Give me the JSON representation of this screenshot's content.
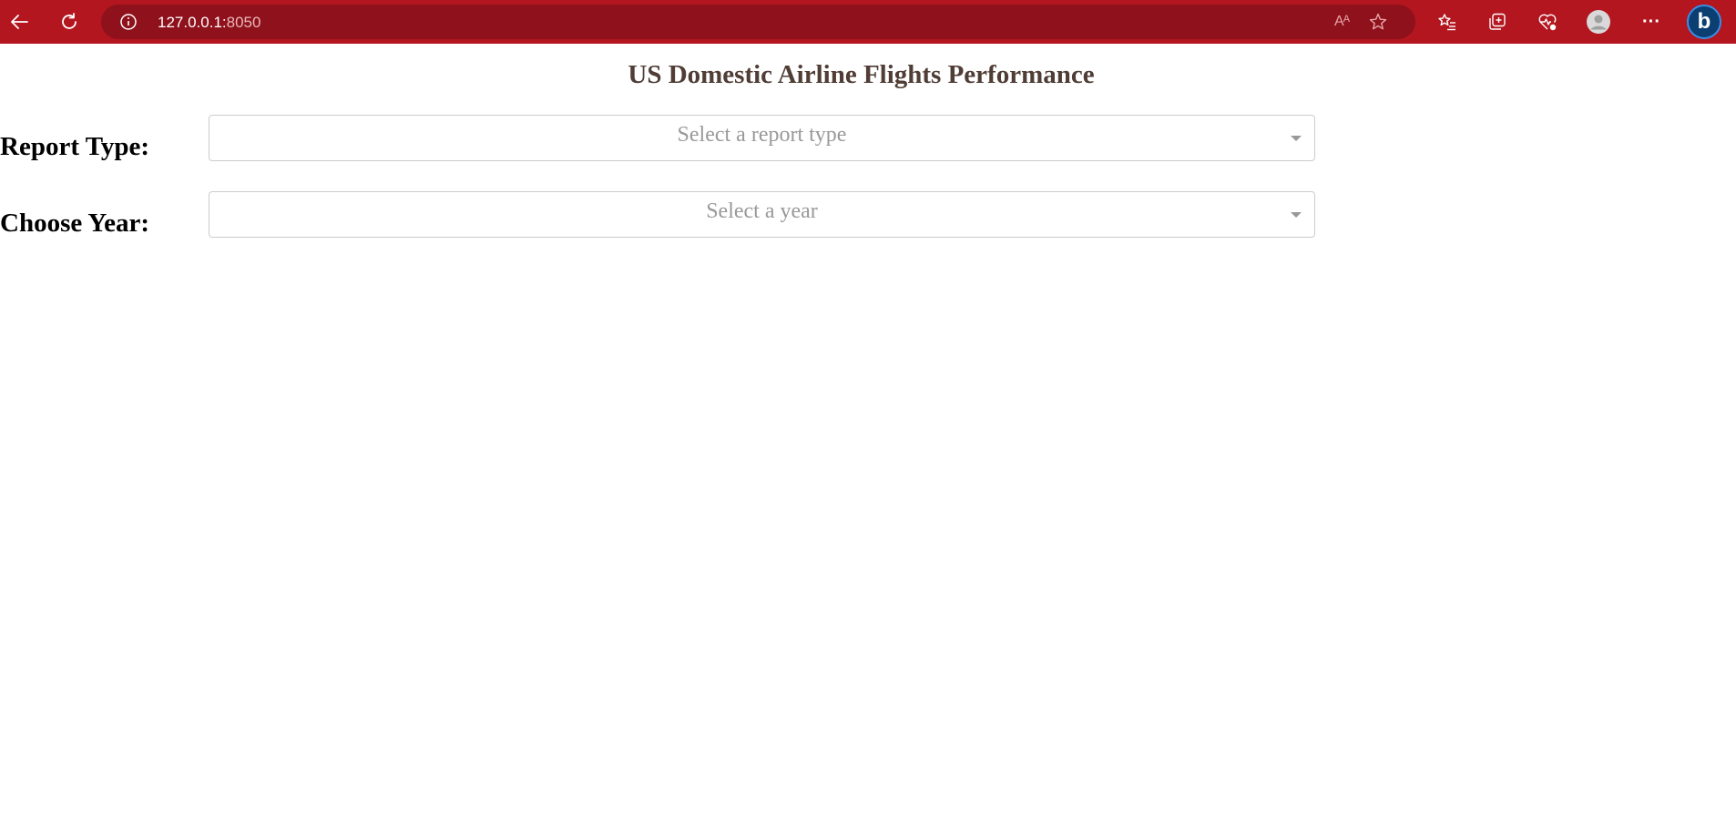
{
  "browser": {
    "address_host": "127.0.0.1:",
    "address_port": "8050",
    "read_aloud_glyph": "Aᴬ",
    "icons": {
      "back": "back-arrow-icon",
      "refresh": "refresh-icon",
      "info": "info-icon",
      "read_aloud": "read-aloud-icon",
      "favorite": "star-icon",
      "favorites": "favorites-list-icon",
      "collections": "collections-icon",
      "health": "browser-essentials-icon",
      "profile": "profile-avatar-icon",
      "more": "more-menu-icon",
      "copilot": "bing-copilot-icon"
    },
    "more_glyph": "···",
    "copilot_glyph": "b",
    "colors": {
      "toolbar": "#b3161f",
      "address_bar": "#8e111b"
    }
  },
  "page": {
    "title": "US Domestic Airline Flights Performance",
    "title_color": "#503d36",
    "report_type": {
      "label": "Report Type:",
      "placeholder": "Select a report type"
    },
    "year": {
      "label": "Choose Year:",
      "placeholder": "Select a year"
    }
  }
}
